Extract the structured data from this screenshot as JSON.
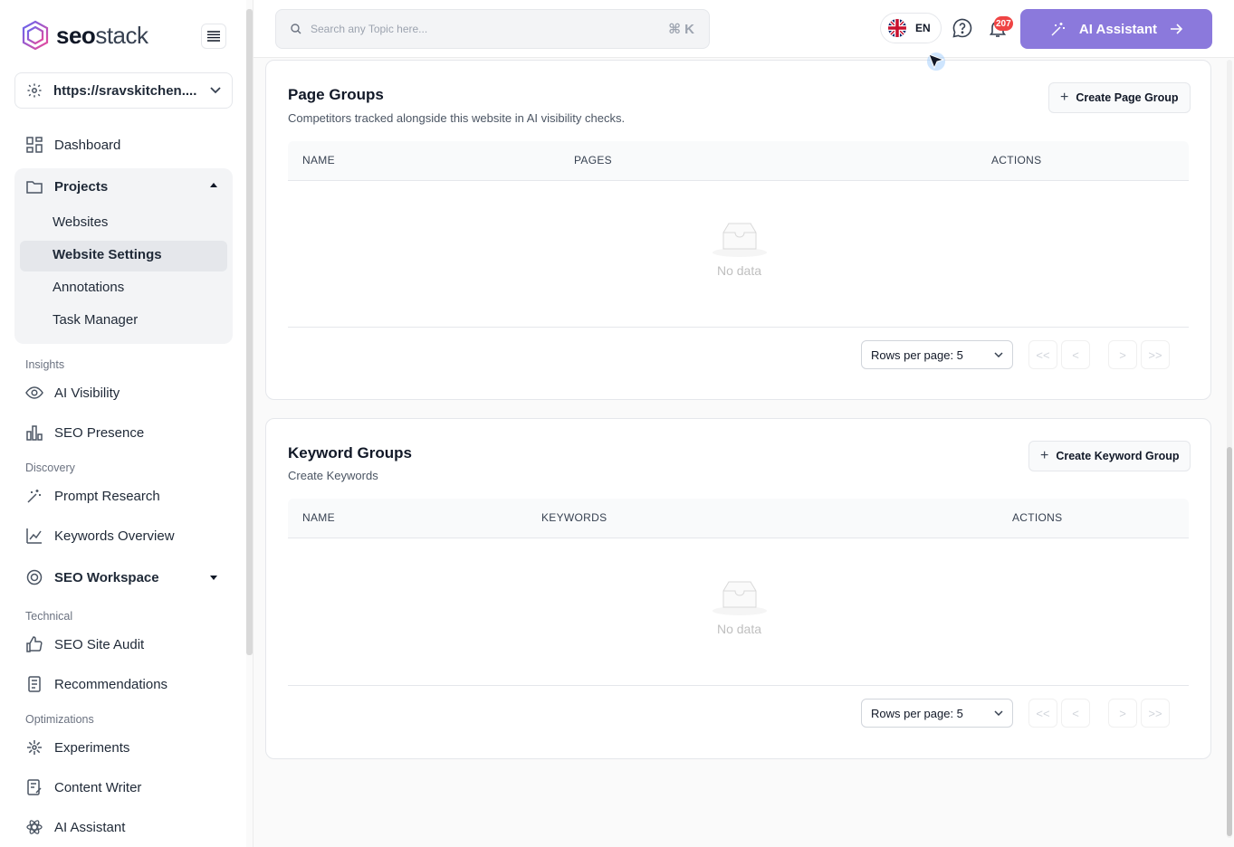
{
  "brand": {
    "name_bold": "seo",
    "name_light": "stack"
  },
  "site_selector": {
    "value": "https://sravskitchen...."
  },
  "nav": {
    "dashboard": "Dashboard",
    "projects": "Projects",
    "projects_sub": [
      "Websites",
      "Website Settings",
      "Annotations",
      "Task Manager"
    ],
    "sections": {
      "insights": "Insights",
      "discovery": "Discovery",
      "technical": "Technical",
      "optimizations": "Optimizations"
    },
    "ai_visibility": "AI Visibility",
    "seo_presence": "SEO Presence",
    "prompt_research": "Prompt Research",
    "keywords_overview": "Keywords Overview",
    "seo_workspace": "SEO Workspace",
    "seo_site_audit": "SEO Site Audit",
    "recommendations": "Recommendations",
    "experiments": "Experiments",
    "content_writer": "Content Writer",
    "ai_assistant": "AI Assistant"
  },
  "topbar": {
    "search_placeholder": "Search any Topic here...",
    "search_shortcut": "⌘ K",
    "language": "EN",
    "notifications_count": "207",
    "ai_button": "AI Assistant"
  },
  "page_groups": {
    "title": "Page Groups",
    "subtitle": "Competitors tracked alongside this website in AI visibility checks.",
    "create_label": "Create Page Group",
    "columns": [
      "NAME",
      "PAGES",
      "ACTIONS"
    ],
    "empty_text": "No data",
    "rows_per_page": "Rows per page: 5"
  },
  "keyword_groups": {
    "title": "Keyword Groups",
    "subtitle": "Create Keywords",
    "create_label": "Create Keyword Group",
    "columns": [
      "NAME",
      "KEYWORDS",
      "ACTIONS"
    ],
    "empty_text": "No data",
    "rows_per_page": "Rows per page: 5"
  },
  "colors": {
    "accent": "#8b79dc",
    "badge": "#ef4444",
    "logo_gradient_start": "#6366f1",
    "logo_gradient_end": "#ec4899"
  }
}
